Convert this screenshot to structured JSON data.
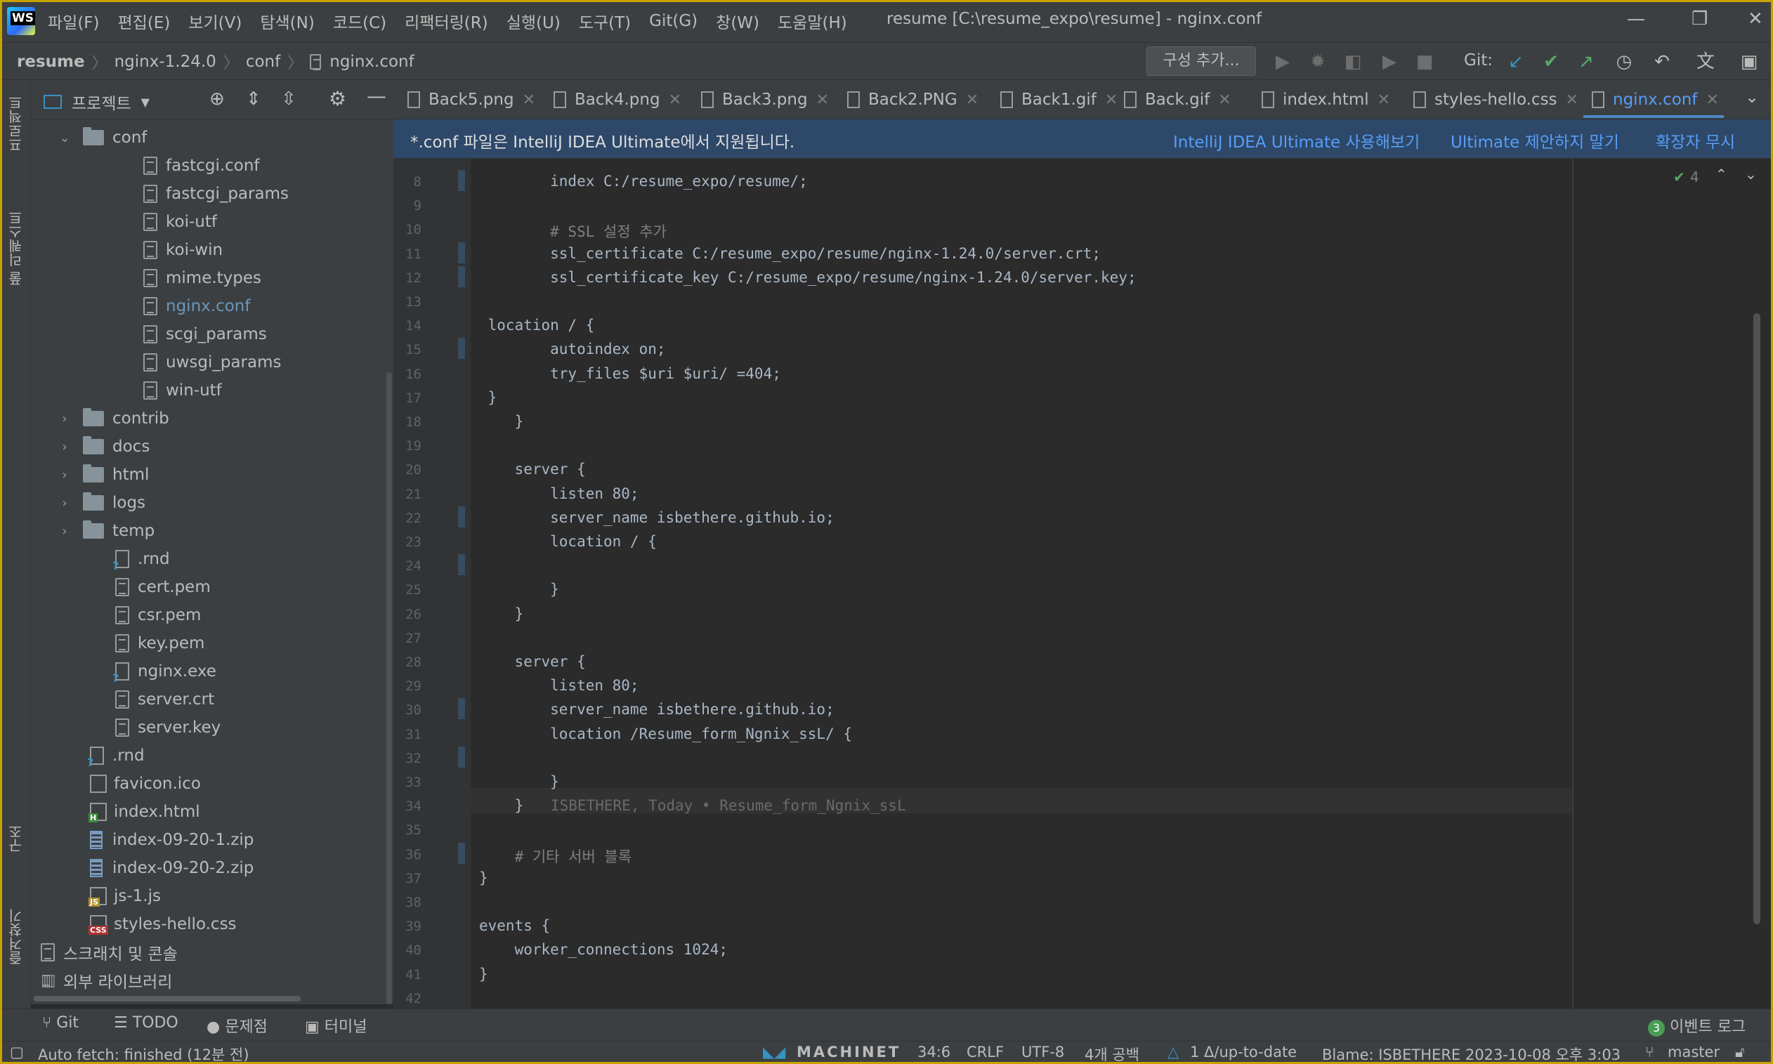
{
  "app": {
    "logo_text": "WS",
    "window_title": "resume [C:\\resume_expo\\resume] - nginx.conf"
  },
  "menu": [
    "파일(F)",
    "편집(E)",
    "보기(V)",
    "탐색(N)",
    "코드(C)",
    "리팩터링(R)",
    "실행(U)",
    "도구(T)",
    "Git(G)",
    "창(W)",
    "도움말(H)"
  ],
  "breadcrumb": [
    "resume",
    "nginx-1.24.0",
    "conf",
    "nginx.conf"
  ],
  "toolbar": {
    "config_label": "구성 추가...",
    "git_label": "Git:"
  },
  "left_strip": {
    "project": "프로젝트",
    "pull_requests": "풀 리퀘스트",
    "structure": "구조",
    "favorites": "즐겨찾기"
  },
  "project_panel": {
    "title": "프로젝트"
  },
  "tree": [
    {
      "label": "conf",
      "type": "folder-open",
      "level": 1
    },
    {
      "label": "fastcgi.conf",
      "type": "file",
      "level": 2
    },
    {
      "label": "fastcgi_params",
      "type": "file",
      "level": 2
    },
    {
      "label": "koi-utf",
      "type": "file",
      "level": 2
    },
    {
      "label": "koi-win",
      "type": "file",
      "level": 2
    },
    {
      "label": "mime.types",
      "type": "file",
      "level": 2
    },
    {
      "label": "nginx.conf",
      "type": "file",
      "level": 2,
      "selected": true
    },
    {
      "label": "scgi_params",
      "type": "file",
      "level": 2
    },
    {
      "label": "uwsgi_params",
      "type": "file",
      "level": 2
    },
    {
      "label": "win-utf",
      "type": "file",
      "level": 2
    },
    {
      "label": "contrib",
      "type": "folder",
      "level": 1
    },
    {
      "label": "docs",
      "type": "folder",
      "level": 1
    },
    {
      "label": "html",
      "type": "folder",
      "level": 1
    },
    {
      "label": "logs",
      "type": "folder",
      "level": 1
    },
    {
      "label": "temp",
      "type": "folder",
      "level": 1
    },
    {
      "label": ".rnd",
      "type": "unknown",
      "level": 1
    },
    {
      "label": "cert.pem",
      "type": "file",
      "level": 1
    },
    {
      "label": "csr.pem",
      "type": "file",
      "level": 1
    },
    {
      "label": "key.pem",
      "type": "file",
      "level": 1
    },
    {
      "label": "nginx.exe",
      "type": "unknown",
      "level": 1
    },
    {
      "label": "server.crt",
      "type": "file",
      "level": 1
    },
    {
      "label": "server.key",
      "type": "file",
      "level": 1
    },
    {
      "label": ".rnd",
      "type": "unknown",
      "level": 0
    },
    {
      "label": "favicon.ico",
      "type": "image",
      "level": 0
    },
    {
      "label": "index.html",
      "type": "html",
      "level": 0
    },
    {
      "label": "index-09-20-1.zip",
      "type": "zip",
      "level": 0
    },
    {
      "label": "index-09-20-2.zip",
      "type": "zip",
      "level": 0
    },
    {
      "label": "js-1.js",
      "type": "js",
      "level": 0
    },
    {
      "label": "styles-hello.css",
      "type": "css",
      "level": 0
    },
    {
      "label": "스크래치 및 콘솔",
      "type": "scratch",
      "level": -1
    },
    {
      "label": "외부 라이브러리",
      "type": "library",
      "level": -1
    }
  ],
  "tabs": [
    {
      "label": "Back5.png",
      "active": false
    },
    {
      "label": "Back4.png",
      "active": false
    },
    {
      "label": "Back3.png",
      "active": false
    },
    {
      "label": "Back2.PNG",
      "active": false
    },
    {
      "label": "Back1.gif",
      "active": false
    },
    {
      "label": "Back.gif",
      "active": false
    },
    {
      "label": "index.html",
      "active": false
    },
    {
      "label": "styles-hello.css",
      "active": false
    },
    {
      "label": "nginx.conf",
      "active": true
    }
  ],
  "banner": {
    "text": "*.conf 파일은 IntelliJ IDEA Ultimate에서 지원됩니다.",
    "link1": "IntelliJ IDEA Ultimate 사용해보기",
    "link2": "Ultimate 제안하지 말기",
    "link3": "확장자 무시"
  },
  "inspection_count": "4",
  "code_lines": [
    {
      "n": "8",
      "text": "        index C:/resume_expo/resume/;"
    },
    {
      "n": "9",
      "text": ""
    },
    {
      "n": "10",
      "text": "        # SSL 설정 추가",
      "comment": true
    },
    {
      "n": "11",
      "text": "        ssl_certificate C:/resume_expo/resume/nginx-1.24.0/server.crt;"
    },
    {
      "n": "12",
      "text": "        ssl_certificate_key C:/resume_expo/resume/nginx-1.24.0/server.key;"
    },
    {
      "n": "13",
      "text": ""
    },
    {
      "n": "14",
      "text": " location / {"
    },
    {
      "n": "15",
      "text": "        autoindex on;"
    },
    {
      "n": "16",
      "text": "        try_files $uri $uri/ =404;"
    },
    {
      "n": "17",
      "text": " }"
    },
    {
      "n": "18",
      "text": "    }"
    },
    {
      "n": "19",
      "text": ""
    },
    {
      "n": "20",
      "text": "    server {"
    },
    {
      "n": "21",
      "text": "        listen 80;"
    },
    {
      "n": "22",
      "text": "        server_name isbethere.github.io;"
    },
    {
      "n": "23",
      "text": "        location / {"
    },
    {
      "n": "24",
      "text": ""
    },
    {
      "n": "25",
      "text": "        }"
    },
    {
      "n": "26",
      "text": "    }"
    },
    {
      "n": "27",
      "text": ""
    },
    {
      "n": "28",
      "text": "    server {"
    },
    {
      "n": "29",
      "text": "        listen 80;"
    },
    {
      "n": "30",
      "text": "        server_name isbethere.github.io;"
    },
    {
      "n": "31",
      "text": "        location /Resume_form_Ngnix_ssL/ {"
    },
    {
      "n": "32",
      "text": ""
    },
    {
      "n": "33",
      "text": "        }"
    },
    {
      "n": "34",
      "text": "    }"
    },
    {
      "n": "35",
      "text": ""
    },
    {
      "n": "36",
      "text": "    # 기타 서버 블록",
      "comment": true
    },
    {
      "n": "37",
      "text": "}"
    },
    {
      "n": "38",
      "text": ""
    },
    {
      "n": "39",
      "text": "events {"
    },
    {
      "n": "40",
      "text": "    worker_connections 1024;"
    },
    {
      "n": "41",
      "text": "}"
    },
    {
      "n": "42",
      "text": ""
    }
  ],
  "blame_inline": "ISBETHERE, Today • Resume_form_Ngnix_ssL",
  "bottom_tools": [
    "Git",
    "TODO",
    "문제점",
    "터미널"
  ],
  "event_log": {
    "count": "3",
    "label": "이벤트 로그"
  },
  "status": {
    "left": "Auto fetch: finished (12분 전)",
    "machinet": "MACHINET",
    "position": "34:6",
    "line_sep": "CRLF",
    "encoding": "UTF-8",
    "indent": "4개 공백",
    "git_status": "1 Δ/up-to-date",
    "blame": "Blame: ISBETHERE 2023-10-08 오후 3:03",
    "branch": "master"
  },
  "colors": {
    "accent": "#589df6",
    "banner_bg": "#2d4869",
    "bg": "#2b2b2b",
    "panel": "#3c3f41"
  }
}
